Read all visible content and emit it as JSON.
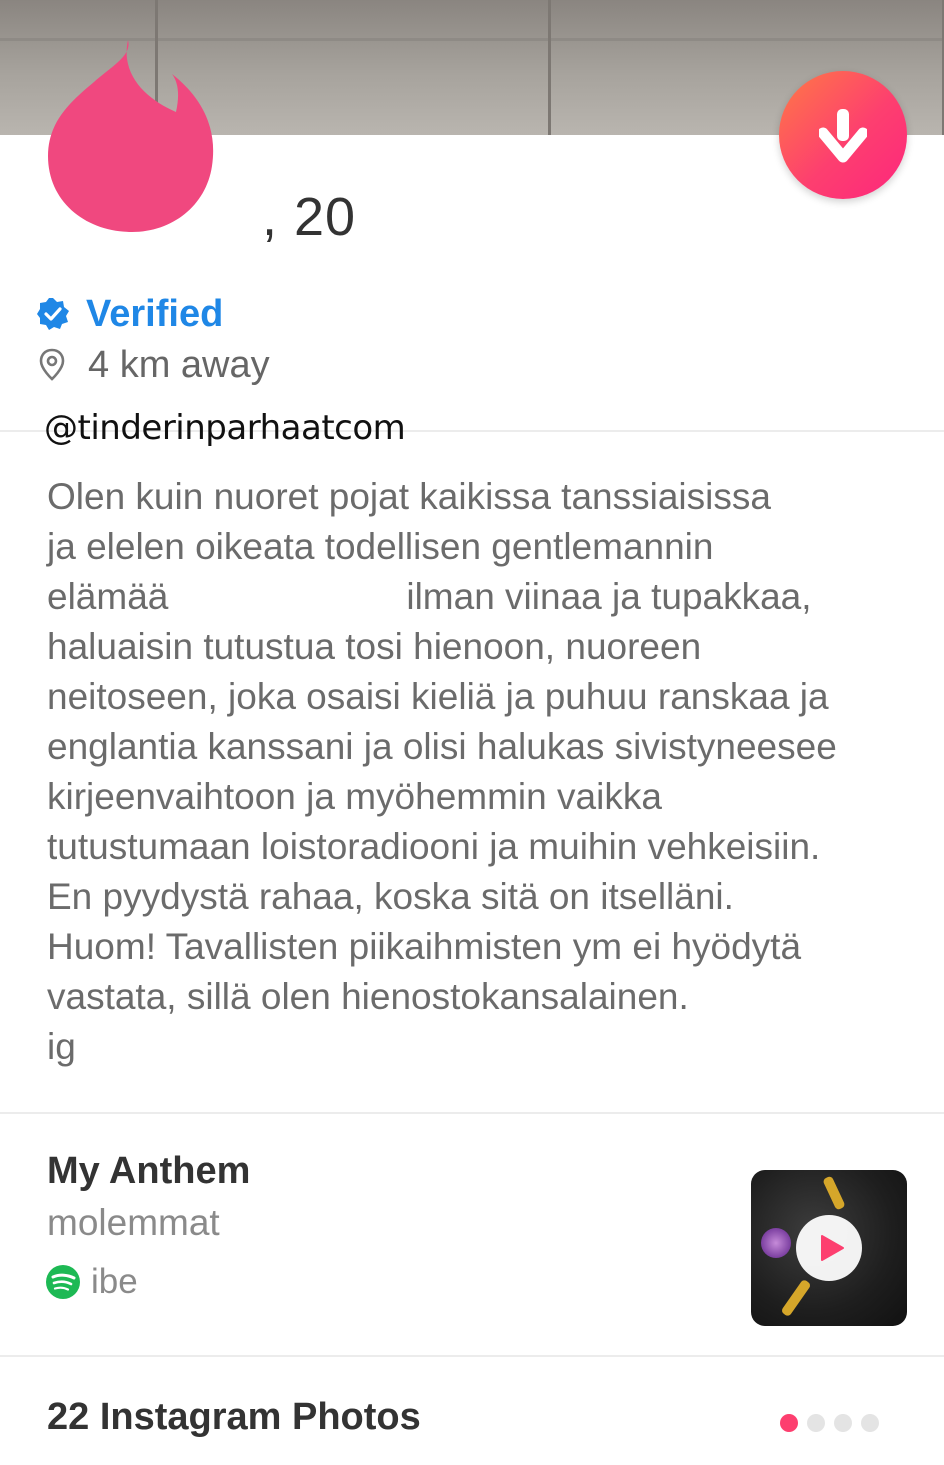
{
  "profile": {
    "name_age": ", 20",
    "verified_label": "Verified",
    "distance": "4 km away"
  },
  "watermark": "@tinderinparhaatcom",
  "bio": {
    "lines": [
      "Olen kuin nuoret pojat kaikissa tanssiaisissa",
      "ja elelen oikeata todellisen gentlemannin",
      "elämää",
      "ilman viinaa ja tupakkaa,",
      "haluaisin tutustua tosi hienoon, nuoreen",
      "neitoseen, joka osaisi kieliä ja puhuu ranskaa ja",
      "englantia kanssani ja olisi halukas sivistyneesee",
      "kirjeenvaihtoon ja myöhemmin vaikka",
      "tutustumaan loistoradiooni ja muihin vehkeisiin.",
      "En pyydystä rahaa, koska sitä on itselläni.",
      "Huom! Tavallisten piikaihmisten ym ei hyödytä",
      "vastata, sillä olen hienostokansalainen.",
      "ig"
    ]
  },
  "anthem": {
    "title": "My Anthem",
    "song": "molemmat",
    "artist": "ibe"
  },
  "instagram": {
    "title": "22 Instagram Photos",
    "page_count": 4,
    "active_page": 1
  },
  "icons": {
    "logo": "tinder-flame-icon",
    "collapse": "arrow-down-icon",
    "verified": "verified-badge-icon",
    "location": "location-pin-icon",
    "music": "spotify-icon",
    "play": "play-icon"
  },
  "colors": {
    "accent": "#fd3f6f",
    "verified_blue": "#1f87e6",
    "spotify_green": "#1db954"
  }
}
